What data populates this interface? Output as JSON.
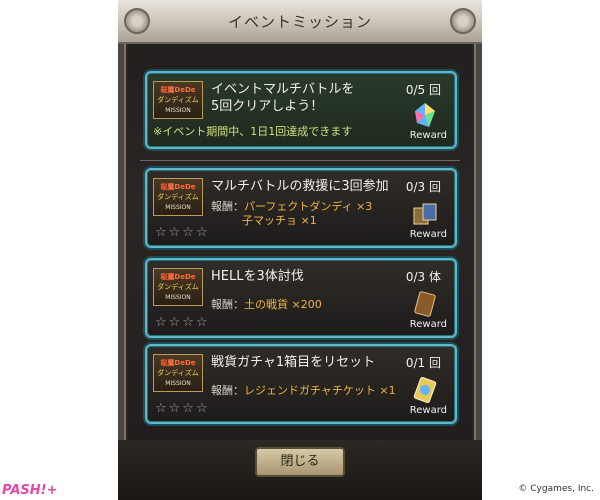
{
  "dialog": {
    "title": "イベントミッション",
    "close_label": "閉じる"
  },
  "top_mission": {
    "badge": [
      "桜鷹DeDe",
      "ダンディズム",
      "MISSION"
    ],
    "title_line1": "イベントマルチバトルを",
    "title_line2": "5回クリアしよう！",
    "count": "0/5 回",
    "note": "※イベント期間中、1日1回達成できます",
    "reward_label": "Reward"
  },
  "missions": [
    {
      "badge": [
        "桜鷹DeDe",
        "ダンディズム",
        "MISSION"
      ],
      "title": "マルチバトルの救援に3回参加",
      "count": "0/3 回",
      "reward_prefix": "報酬：",
      "reward_values": [
        "パーフェクトダンディ ×3",
        "子マッチョ ×1"
      ],
      "stars": "☆☆☆☆",
      "reward_label": "Reward"
    },
    {
      "badge": [
        "桜鷹DeDe",
        "ダンディズム",
        "MISSION"
      ],
      "title": "HELLを3体討伐",
      "count": "0/3 体",
      "reward_prefix": "報酬：",
      "reward_values": [
        "土の戦貨 ×200"
      ],
      "stars": "☆☆☆☆",
      "reward_label": "Reward"
    },
    {
      "badge": [
        "桜鷹DeDe",
        "ダンディズム",
        "MISSION"
      ],
      "title": "戦貨ガチャ1箱目をリセット",
      "count": "0/1 回",
      "reward_prefix": "報酬：",
      "reward_values": [
        "レジェンドガチャチケット ×1"
      ],
      "stars": "☆☆☆☆",
      "reward_label": "Reward"
    }
  ],
  "footer": {
    "watermark": "PASH!+",
    "copyright": "© Cygames, Inc."
  }
}
